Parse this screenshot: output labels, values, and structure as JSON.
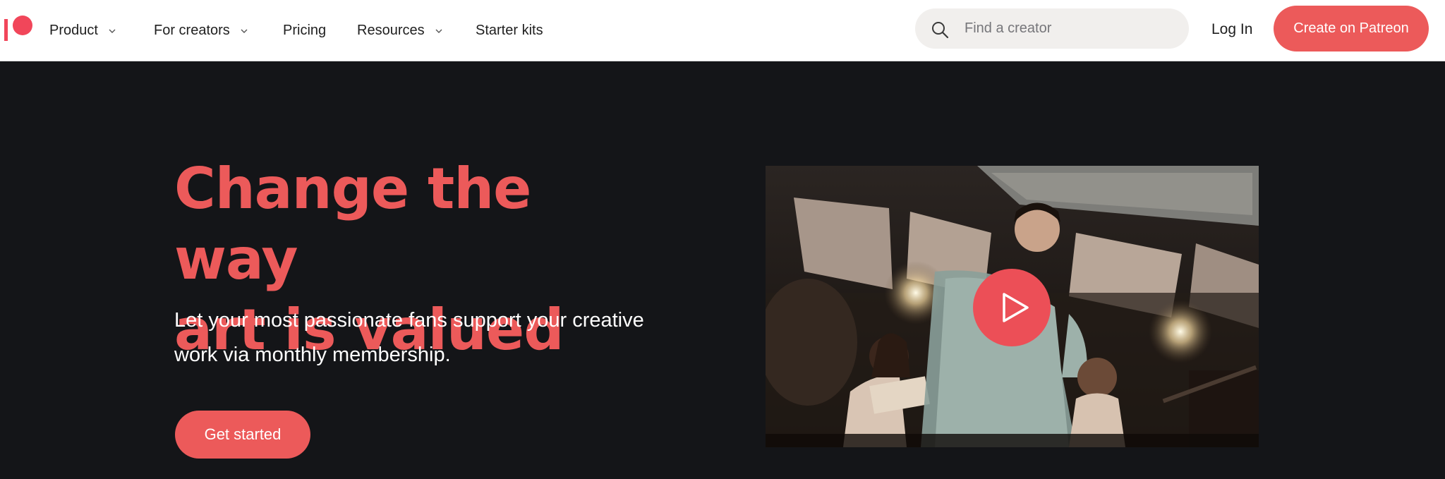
{
  "brand": {
    "logo_icon": "patreon-logo-icon",
    "accent_color": "#ec5a5a"
  },
  "nav": {
    "items": [
      {
        "label": "Product",
        "has_dropdown": true
      },
      {
        "label": "For creators",
        "has_dropdown": true
      },
      {
        "label": "Pricing",
        "has_dropdown": false
      },
      {
        "label": "Resources",
        "has_dropdown": true
      },
      {
        "label": "Starter kits",
        "has_dropdown": false
      }
    ]
  },
  "search": {
    "placeholder": "Find a creator",
    "icon": "search-icon"
  },
  "auth": {
    "login_label": "Log In",
    "create_label": "Create on Patreon"
  },
  "hero": {
    "headline_line1": "Change the way",
    "headline_line2": "art is valued",
    "subtext_line1": "Let your most passionate fans support your creative",
    "subtext_line2": "work via monthly membership.",
    "cta_label": "Get started"
  },
  "video": {
    "play_icon": "play-icon"
  }
}
